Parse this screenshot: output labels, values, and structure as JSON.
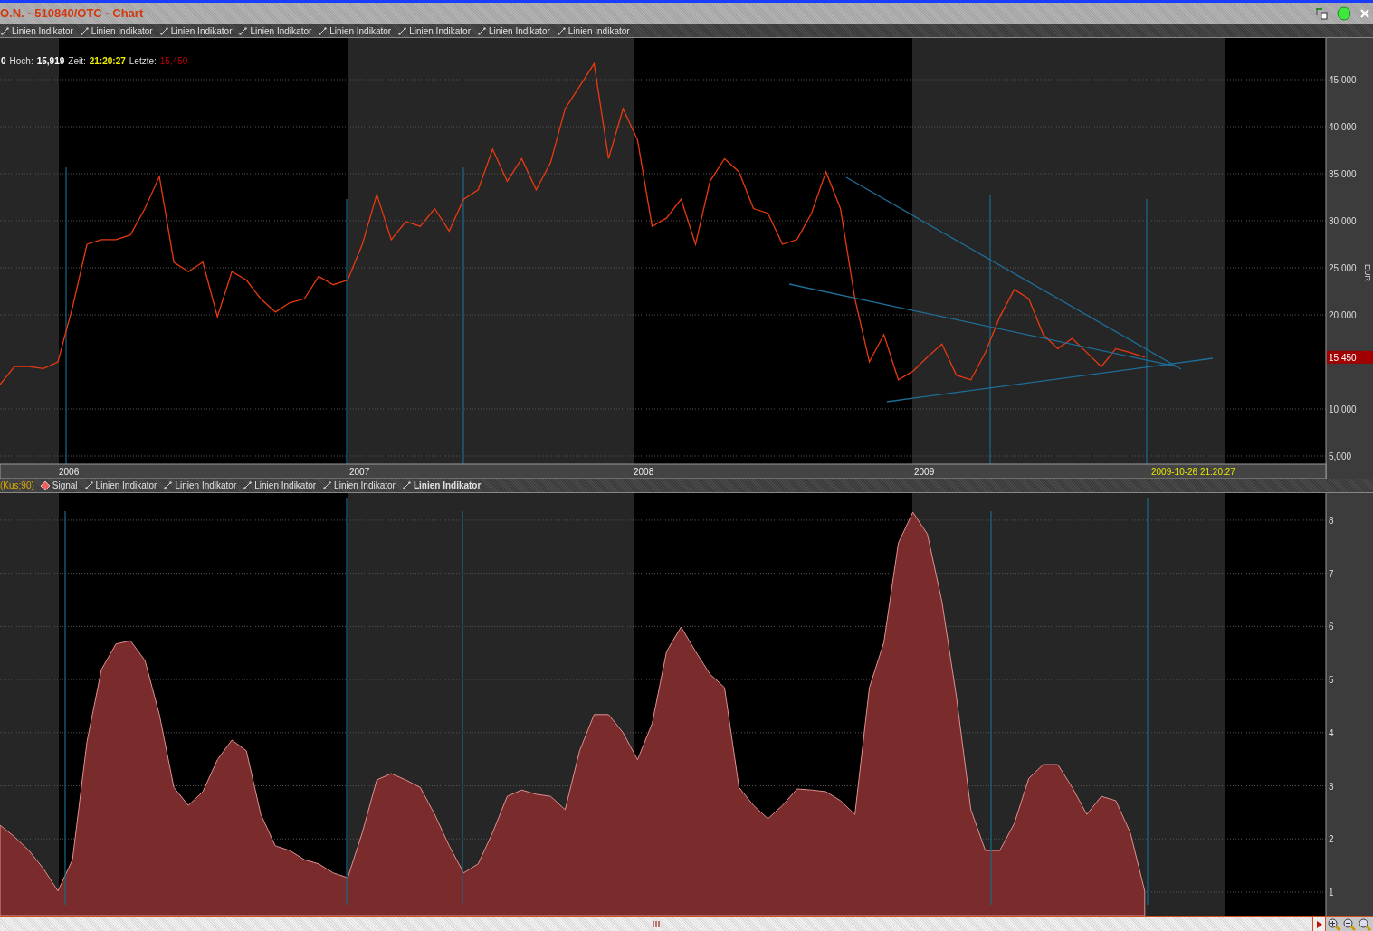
{
  "window": {
    "title": "O.N. - 510840/OTC - Chart"
  },
  "toolbar": {
    "items": [
      {
        "label": "Linien Indikator",
        "selected": false
      },
      {
        "label": "Linien Indikator",
        "selected": false
      },
      {
        "label": "Linien Indikator",
        "selected": false
      },
      {
        "label": "Linien Indikator",
        "selected": false
      },
      {
        "label": "Linien Indikator",
        "selected": false
      },
      {
        "label": "Linien Indikator",
        "selected": false
      },
      {
        "label": "Linien Indikator",
        "selected": false
      },
      {
        "label": "Linien Indikator",
        "selected": false
      }
    ]
  },
  "info": {
    "prefix": "0",
    "high_label": "Hoch:",
    "high": "15,919",
    "time_label": "Zeit:",
    "time": "21:20:27",
    "last_label": "Letzte:",
    "last": "15,450"
  },
  "price_chart": {
    "axis_unit": "EUR",
    "last_price_tag": "15,450",
    "cursor_date": "2009-10-26 21:20:27",
    "date_labels": [
      "2006",
      "2007",
      "2008",
      "2009"
    ],
    "chart_data": {
      "type": "line",
      "grid": true,
      "ylim": [
        4135,
        49423
      ],
      "yticks": [
        {
          "value": 5000,
          "label": "5,000"
        },
        {
          "value": 10000,
          "label": "10,000"
        },
        {
          "value": 20000,
          "label": "20,000"
        },
        {
          "value": 25000,
          "label": "25,000"
        },
        {
          "value": 30000,
          "label": "30,000"
        },
        {
          "value": 35000,
          "label": "35,000"
        },
        {
          "value": 40000,
          "label": "40,000"
        },
        {
          "value": 45000,
          "label": "45,000"
        }
      ],
      "series": [
        {
          "color": "#e83a10",
          "values": [
            12600,
            14500,
            14500,
            14300,
            15000,
            20800,
            27500,
            28000,
            28000,
            28500,
            31300,
            34700,
            25600,
            24600,
            25600,
            19800,
            24600,
            23700,
            21700,
            20300,
            21300,
            21700,
            24100,
            23200,
            23700,
            27500,
            32800,
            28000,
            29900,
            29400,
            31300,
            28900,
            32300,
            33300,
            37600,
            34200,
            36600,
            33300,
            36200,
            41900,
            44300,
            46700,
            36600,
            41900,
            38600,
            29400,
            30300,
            32300,
            27500,
            34200,
            36600,
            35200,
            31300,
            30800,
            27500,
            28000,
            30800,
            35200,
            31300,
            21700,
            15000,
            17900,
            13100,
            14000,
            15500,
            16900,
            13600,
            13100,
            16000,
            19800,
            22700,
            21700,
            17900,
            16400,
            17500,
            16000,
            14500,
            16400,
            16000,
            15500
          ]
        }
      ]
    }
  },
  "indicator_toolbar": {
    "parameter": "(Kus;90)",
    "signal": "Signal",
    "items": [
      {
        "label": "Linien Indikator",
        "selected": false
      },
      {
        "label": "Linien Indikator",
        "selected": false
      },
      {
        "label": "Linien Indikator",
        "selected": false
      },
      {
        "label": "Linien Indikator",
        "selected": false
      },
      {
        "label": "Linien Indikator",
        "selected": true
      }
    ]
  },
  "indicator_chart": {
    "chart_data": {
      "type": "area",
      "grid": true,
      "ylim": [
        0.556,
        8.51
      ],
      "yticks": [
        1,
        2,
        3,
        4,
        5,
        6,
        7,
        8
      ],
      "series": [
        {
          "color": "#7a2c2c",
          "values": [
            2.26,
            2.04,
            1.78,
            1.44,
            1.02,
            1.61,
            3.83,
            5.19,
            5.67,
            5.73,
            5.36,
            4.34,
            2.97,
            2.63,
            2.89,
            3.49,
            3.86,
            3.66,
            2.46,
            1.87,
            1.78,
            1.61,
            1.53,
            1.36,
            1.27,
            2.12,
            3.11,
            3.23,
            3.11,
            2.97,
            2.46,
            1.87,
            1.36,
            1.53,
            2.12,
            2.8,
            2.92,
            2.84,
            2.8,
            2.55,
            3.66,
            4.34,
            4.34,
            4.0,
            3.49,
            4.17,
            5.53,
            5.99,
            5.53,
            5.1,
            4.85,
            2.97,
            2.63,
            2.38,
            2.63,
            2.94,
            2.92,
            2.89,
            2.72,
            2.46,
            4.85,
            5.7,
            7.57,
            8.15,
            7.74,
            6.47,
            4.68,
            2.55,
            1.78,
            1.78,
            2.29,
            3.14,
            3.4,
            3.4,
            2.97,
            2.46,
            2.8,
            2.72,
            2.12,
            1.02
          ]
        }
      ]
    }
  }
}
